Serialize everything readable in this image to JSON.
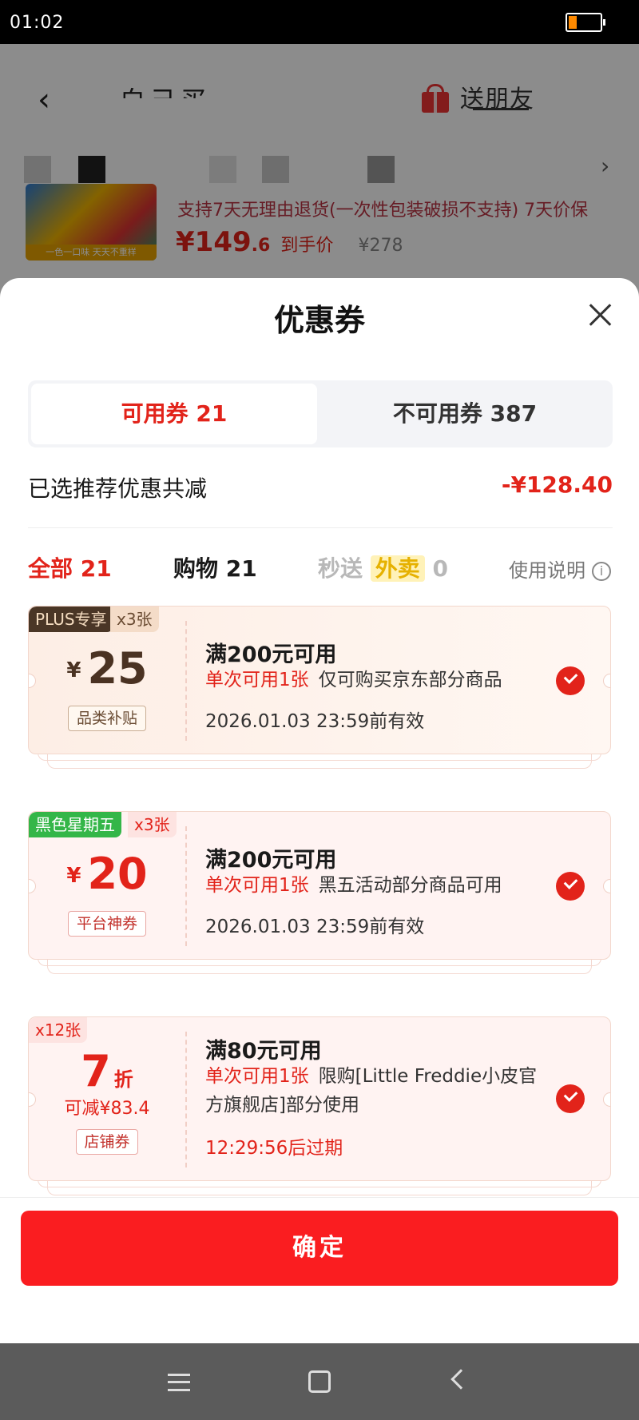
{
  "status_bar": {
    "time": "01:02"
  },
  "background": {
    "back_icon": "chevron-left-icon",
    "title_partial": "白己买",
    "gift_icon": "gift-icon",
    "send_friend_label": "送朋友",
    "product": {
      "image_band_text": "一色一口味 天天不重样",
      "policy": "支持7天无理由退货(一次性包装破损不支持) 7天价保",
      "price_int": "¥149",
      "price_dec": ".6",
      "price_label": "到手价",
      "original_price": "¥278"
    }
  },
  "sheet": {
    "title": "优惠券",
    "close_icon": "close-icon",
    "tabs": [
      {
        "label": "可用券 21",
        "active": true
      },
      {
        "label": "不可用券 387",
        "active": false
      }
    ],
    "summary": {
      "label": "已选推荐优惠共减",
      "value": "-¥128.40"
    },
    "filters": {
      "all": "全部 21",
      "shopping": "购物 21",
      "fast_prefix": "秒送",
      "fast_tag": "外卖",
      "fast_count": "0",
      "help": "使用说明",
      "help_icon": "i"
    },
    "coupons": [
      {
        "badge": "PLUS专享",
        "count": "x3张",
        "currency": "¥",
        "amount": "25",
        "type_tag": "品类补贴",
        "condition": "满200元可用",
        "limit": "单次可用1张",
        "scope": "仅可购买京东部分商品",
        "validity": "2026.01.03 23:59前有效",
        "selected": true
      },
      {
        "badge": "黑色星期五",
        "count": "x3张",
        "currency": "¥",
        "amount": "20",
        "type_tag": "平台神券",
        "condition": "满200元可用",
        "limit": "单次可用1张",
        "scope": "黑五活动部分商品可用",
        "validity": "2026.01.03 23:59前有效",
        "selected": true
      },
      {
        "count": "x12张",
        "amount": "7",
        "unit": "折",
        "sub_amount": "可减¥83.4",
        "type_tag": "店铺券",
        "condition": "满80元可用",
        "limit": "单次可用1张",
        "scope": "限购[Little Freddie小皮官方旗舰店]部分使用",
        "validity": "12:29:56后过期",
        "selected": true
      }
    ],
    "confirm_label": "确定"
  },
  "colors": {
    "accent": "#e2231a",
    "confirm": "#fa1d20",
    "plus": "#4a3626",
    "black_friday": "#34b648"
  },
  "nav_bar": {
    "menu_icon": "menu-icon",
    "home_icon": "home-icon",
    "back_icon": "back-icon"
  }
}
